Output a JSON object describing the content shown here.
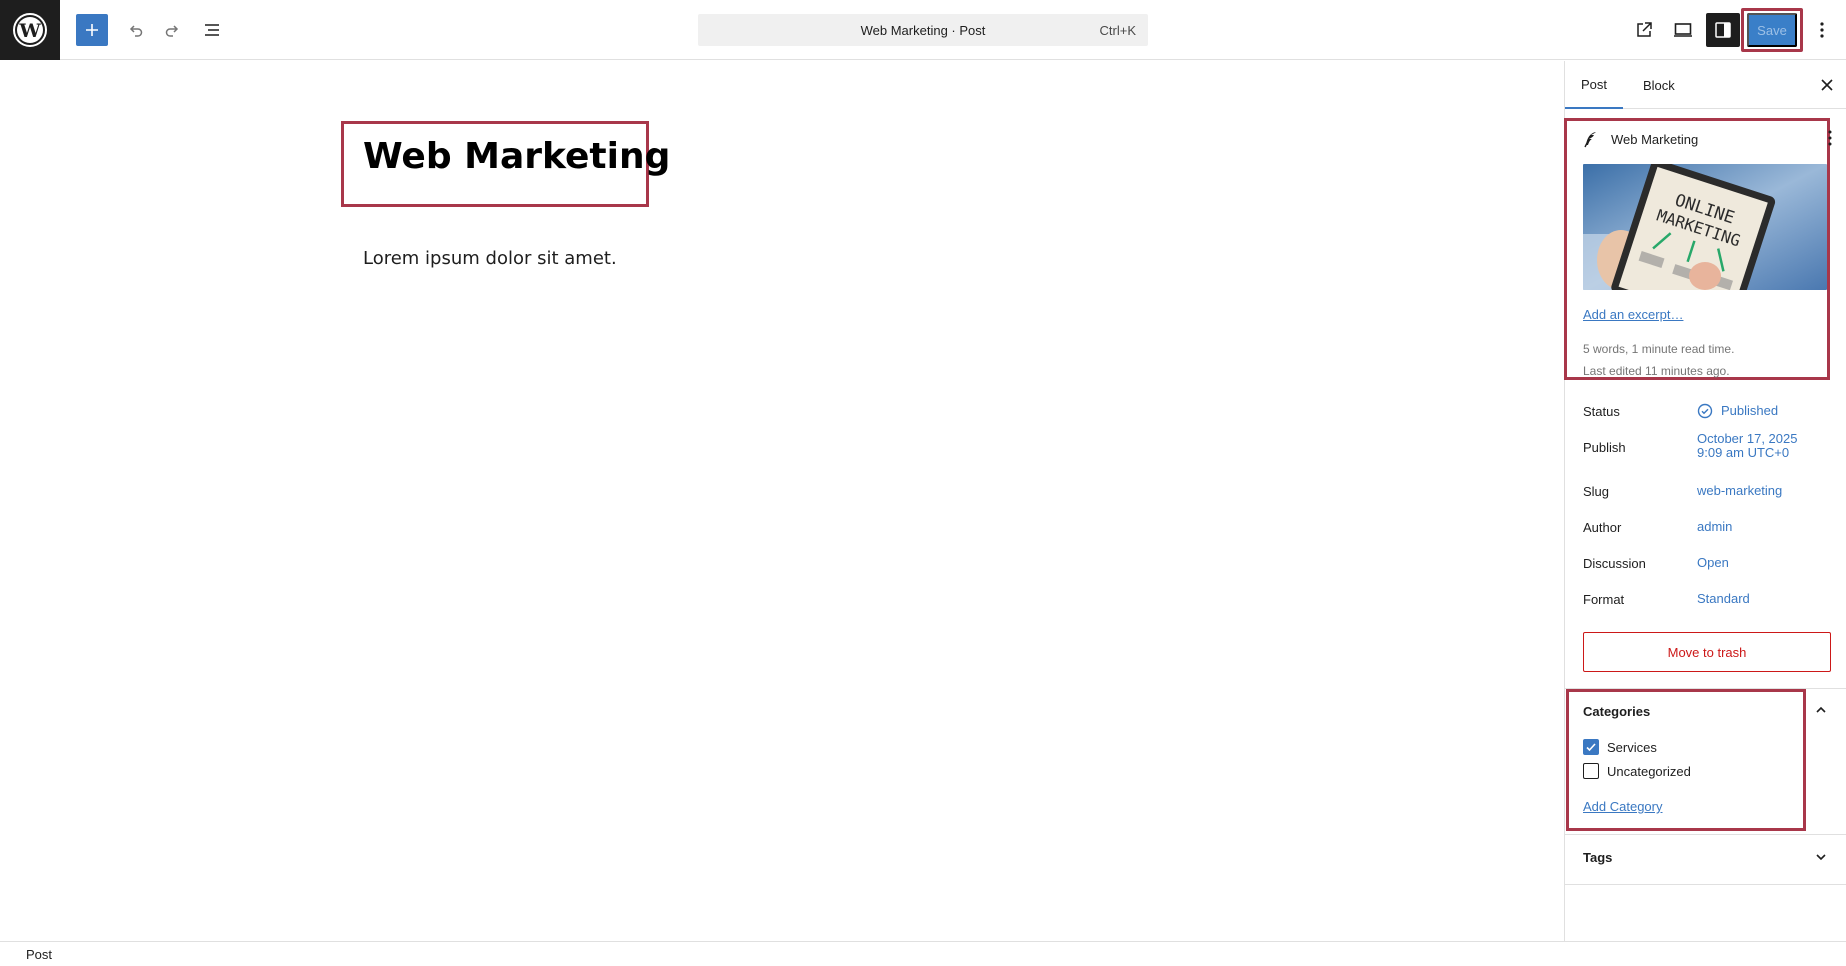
{
  "toolbar": {
    "wp_logo_icon": "wordpress-logo-icon",
    "add_block_icon": "plus-icon",
    "undo_icon": "undo-icon",
    "redo_icon": "redo-icon",
    "document_overview_icon": "list-view-icon",
    "command_title": "Web Marketing · Post",
    "command_shortcut": "Ctrl+K",
    "view_post_icon": "external-link-icon",
    "preview_icon": "desktop-preview-icon",
    "settings_icon": "sidebar-toggle-icon",
    "save_label": "Save",
    "options_icon": "more-vertical-icon"
  },
  "editor": {
    "title": "Web Marketing",
    "paragraph": "Lorem ipsum dolor sit amet."
  },
  "sidebar": {
    "tabs": [
      {
        "label": "Post",
        "active": true
      },
      {
        "label": "Block",
        "active": false
      }
    ],
    "summary": {
      "title": "Web Marketing",
      "image_text_line1": "ONLINE",
      "image_text_line2": "MARKETING",
      "excerpt_link": "Add an excerpt…",
      "word_count": "5 words, 1 minute read time.",
      "last_edited": "Last edited 11 minutes ago."
    },
    "properties": [
      {
        "label": "Status",
        "value": "Published"
      },
      {
        "label": "Publish",
        "value": "October 17, 2025",
        "value2": "9:09 am UTC+0"
      },
      {
        "label": "Slug",
        "value": "web-marketing"
      },
      {
        "label": "Author",
        "value": "admin"
      },
      {
        "label": "Discussion",
        "value": "Open"
      },
      {
        "label": "Format",
        "value": "Standard"
      }
    ],
    "trash_label": "Move to trash",
    "categories": {
      "title": "Categories",
      "items": [
        {
          "label": "Services",
          "checked": true
        },
        {
          "label": "Uncategorized",
          "checked": false
        }
      ],
      "add_link": "Add Category"
    },
    "tags": {
      "title": "Tags"
    }
  },
  "footer": {
    "breadcrumb": "Post"
  },
  "colors": {
    "accent": "#3a78c2",
    "highlight_frame": "#a8374a",
    "danger": "#cc1818"
  }
}
